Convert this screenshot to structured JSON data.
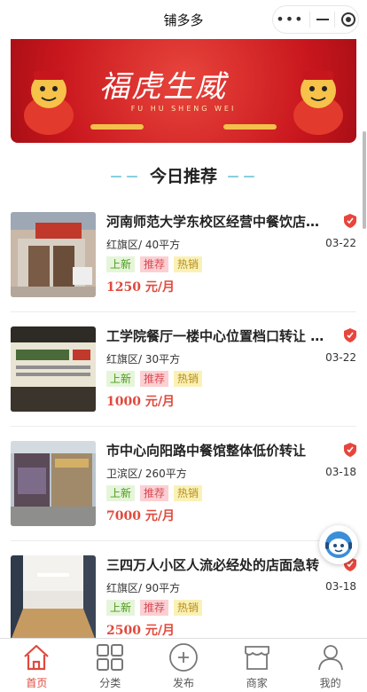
{
  "window": {
    "title": "铺多多"
  },
  "capsule": {
    "more_icon": "more-dots-icon",
    "minimize_icon": "minimize-icon",
    "close_icon": "target-close-icon"
  },
  "banner": {
    "headline": "福虎生威",
    "subline": "FU HU SHENG WEI"
  },
  "section": {
    "title": "今日推荐",
    "dash_left": "－－",
    "dash_right": "－－"
  },
  "listings": [
    {
      "title": "河南师范大学东校区经营中餐饮店…",
      "district": "红旗区",
      "area": "/ 40平方",
      "date": "03-22",
      "tags": [
        "上新",
        "推荐",
        "热销"
      ],
      "price": "1250 元/月"
    },
    {
      "title": "工学院餐厅一楼中心位置档口转让 …",
      "district": "红旗区",
      "area": "/ 30平方",
      "date": "03-22",
      "tags": [
        "上新",
        "推荐",
        "热销"
      ],
      "price": "1000 元/月"
    },
    {
      "title": "市中心向阳路中餐馆整体低价转让",
      "district": "卫滨区",
      "area": "/ 260平方",
      "date": "03-18",
      "tags": [
        "上新",
        "推荐",
        "热销"
      ],
      "price": "7000 元/月"
    },
    {
      "title": "三四万人小区人流必经处的店面急转",
      "district": "红旗区",
      "area": "/ 90平方",
      "date": "03-18",
      "tags": [
        "上新",
        "推荐",
        "热销"
      ],
      "price": "2500 元/月"
    }
  ],
  "tabbar": {
    "items": [
      {
        "label": "首页",
        "icon": "home-icon",
        "active": true
      },
      {
        "label": "分类",
        "icon": "grid-icon",
        "active": false
      },
      {
        "label": "发布",
        "icon": "plus-circle-icon",
        "active": false
      },
      {
        "label": "商家",
        "icon": "shop-icon",
        "active": false
      },
      {
        "label": "我的",
        "icon": "user-icon",
        "active": false
      }
    ]
  },
  "colors": {
    "accent": "#e0493d",
    "banner_red": "#c8161d",
    "tag_new": "#4a9a1c",
    "tag_rec": "#d94b55",
    "tag_hot": "#b88d1b"
  }
}
